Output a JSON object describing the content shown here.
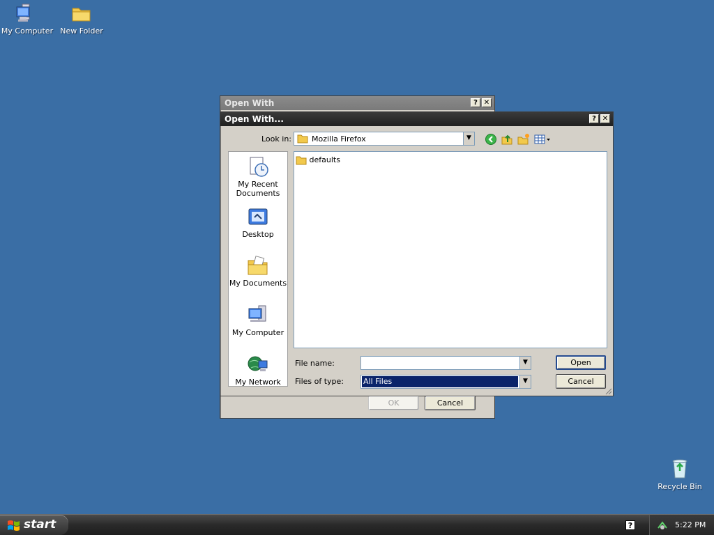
{
  "desktop": {
    "icons": [
      {
        "label": "My Computer",
        "icon": "my-computer-icon"
      },
      {
        "label": "New Folder",
        "icon": "folder-icon"
      },
      {
        "label": "Recycle Bin",
        "icon": "recycle-bin-icon"
      }
    ]
  },
  "back_dialog": {
    "title": "Open With",
    "help_btn": "?",
    "close_btn": "✕",
    "ok_label": "OK",
    "cancel_label": "Cancel"
  },
  "open_dialog": {
    "title": "Open With...",
    "help_btn": "?",
    "close_btn": "✕",
    "look_in_label": "Look in:",
    "look_in_value": "Mozilla Firefox",
    "places": [
      {
        "label": "My Recent Documents",
        "icon": "recent-documents-icon"
      },
      {
        "label": "Desktop",
        "icon": "desktop-icon"
      },
      {
        "label": "My Documents",
        "icon": "my-documents-icon"
      },
      {
        "label": "My Computer",
        "icon": "my-computer-icon"
      },
      {
        "label": "My Network",
        "icon": "my-network-icon"
      }
    ],
    "files": [
      {
        "name": "defaults",
        "icon": "folder-icon"
      }
    ],
    "file_name_label": "File name:",
    "file_name_value": "",
    "files_of_type_label": "Files of type:",
    "files_of_type_value": "All Files",
    "open_label": "Open",
    "cancel_label": "Cancel"
  },
  "taskbar": {
    "start_label": "start",
    "clock": "5:22 PM"
  },
  "colors": {
    "desktop": "#3a6ea5",
    "selection": "#0a246a"
  }
}
